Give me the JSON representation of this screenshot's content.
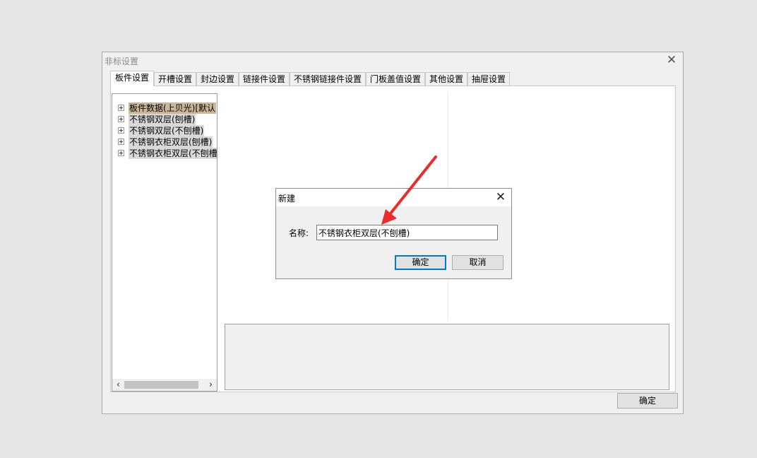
{
  "window": {
    "title": "非标设置",
    "close_glyph": "✕",
    "ok_label": "确定"
  },
  "tabs": [
    {
      "label": "板件设置",
      "active": true
    },
    {
      "label": "开槽设置"
    },
    {
      "label": "封边设置"
    },
    {
      "label": "链接件设置"
    },
    {
      "label": "不锈钢链接件设置"
    },
    {
      "label": "门板盖值设置"
    },
    {
      "label": "其他设置"
    },
    {
      "label": "抽屉设置"
    }
  ],
  "tree": {
    "items": [
      {
        "label": "板件数据(上贝光)[默认",
        "selected": true
      },
      {
        "label": "不锈钢双层(刨槽)"
      },
      {
        "label": "不锈钢双层(不刨槽)"
      },
      {
        "label": "不锈钢衣柜双层(刨槽)"
      },
      {
        "label": "不锈钢衣柜双层(不刨槽"
      }
    ],
    "scroll_left": "‹",
    "scroll_right": "›"
  },
  "dialog": {
    "title": "新建",
    "close_glyph": "✕",
    "name_label": "名称:",
    "name_value": "不锈钢衣柜双层(不刨槽)",
    "ok_label": "确定",
    "cancel_label": "取消"
  },
  "colors": {
    "selected_item_bg": "#cbb69a",
    "annotation_arrow": "#ee2a2a",
    "default_button_border": "#0078d7"
  }
}
